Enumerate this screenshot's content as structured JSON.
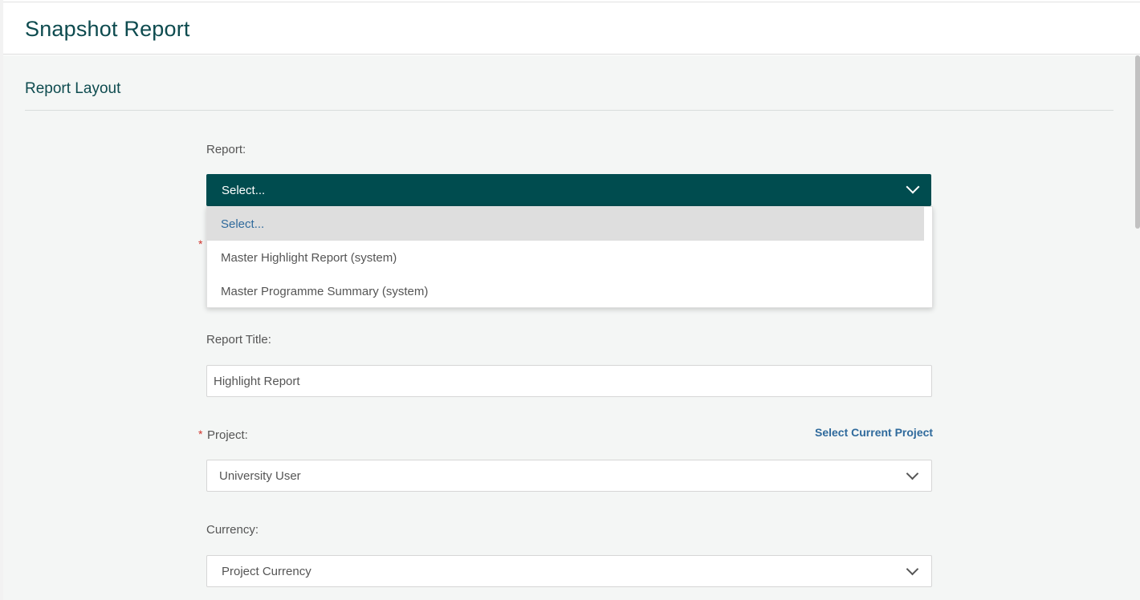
{
  "page": {
    "title": "Snapshot Report"
  },
  "section": {
    "title": "Report Layout"
  },
  "report": {
    "label": "Report:",
    "selected": "Select...",
    "required_marker": "*",
    "options": [
      {
        "label": "Select...",
        "active": true
      },
      {
        "label": "Master Highlight Report (system)",
        "active": false
      },
      {
        "label": "Master Programme Summary (system)",
        "active": false
      }
    ]
  },
  "report_title": {
    "label": "Report Title:",
    "value": "Highlight Report"
  },
  "project": {
    "required_marker": "*",
    "label": "Project:",
    "link": "Select Current Project",
    "value": "University User"
  },
  "currency": {
    "label": "Currency:",
    "value": "Project Currency"
  },
  "colors": {
    "accent": "#004c4f",
    "title": "#0e4b4f",
    "link": "#2f6a9c",
    "required": "#d0342c"
  }
}
